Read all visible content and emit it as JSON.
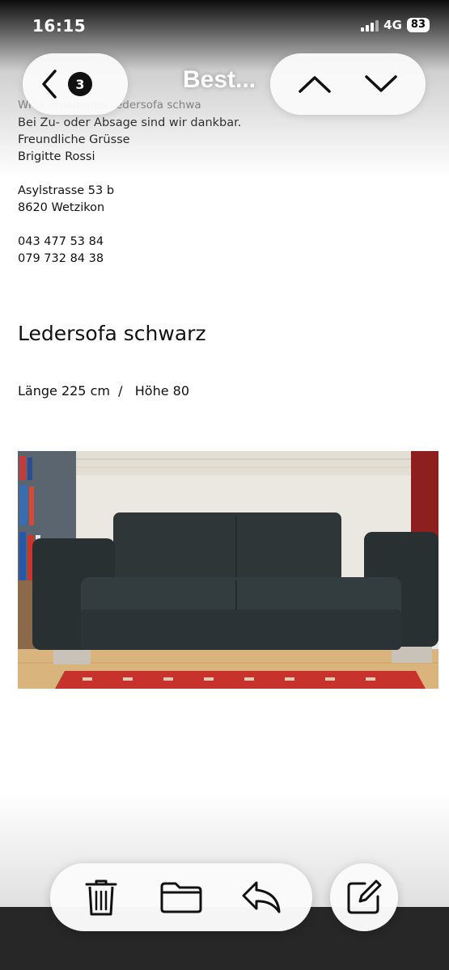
{
  "status_bar": {
    "time": "16:15",
    "network": "4G",
    "battery": "83"
  },
  "nav": {
    "title": "Best...",
    "unread_count": "3",
    "icons": {
      "back": "chevron-left-icon",
      "previous": "chevron-up-icon",
      "next": "chevron-down-icon"
    }
  },
  "email": {
    "faded_line": "Wi                   st erhaltenes Ledersofa schwa",
    "lines": [
      "Bei Zu- oder Absage sind wir dankbar.",
      "Freundliche Grüsse",
      "Brigitte Rossi"
    ],
    "address": [
      "Asylstrasse 53 b",
      "8620 Wetzikon"
    ],
    "phones": [
      "043 477 53 84",
      "079 732 84 38"
    ],
    "heading": "Ledersofa schwarz",
    "dimensions": "Länge 225 cm  /   Höhe 80"
  },
  "toolbar": {
    "icons": [
      "trash-icon",
      "folder-icon",
      "reply-icon",
      "compose-icon"
    ]
  },
  "colors": {
    "sofa": "#2b3336",
    "rug": "#c8322c",
    "floor": "#d8b27a",
    "wall": "#ece9e2",
    "bottom_bar": "#272727"
  }
}
